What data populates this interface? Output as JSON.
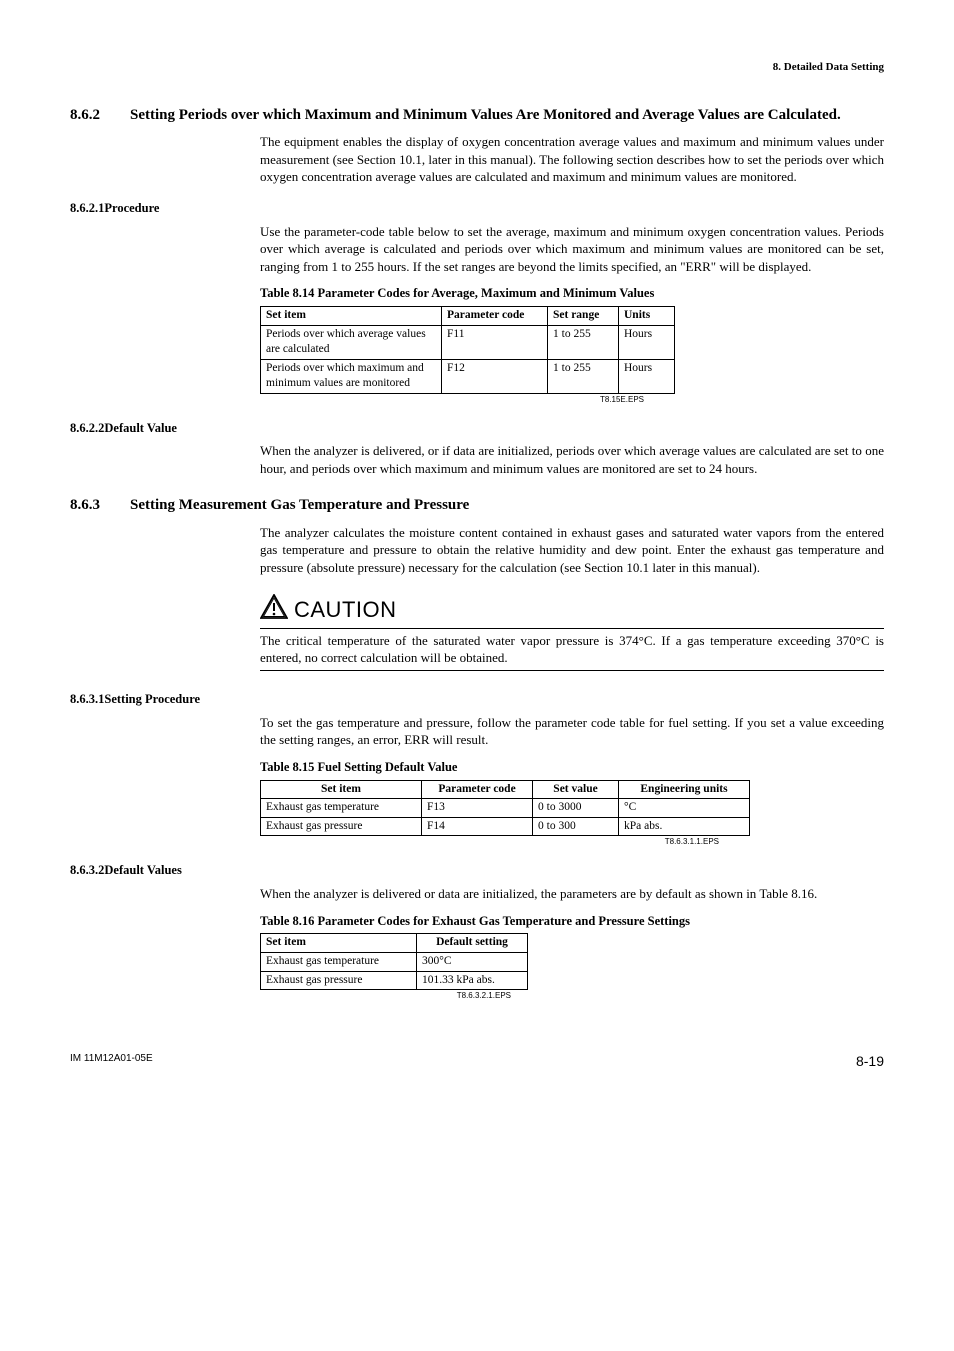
{
  "header": {
    "section": "8.  Detailed Data Setting"
  },
  "s862": {
    "num": "8.6.2",
    "title": "Setting Periods over which Maximum and Minimum Values Are Monitored and Average Values are Calculated.",
    "intro": "The equipment enables the display of oxygen concentration average values and maximum and minimum values under measurement (see Section 10.1, later in this manual). The following section describes how to set the periods over which oxygen concentration average values are calculated and maximum and minimum values are monitored.",
    "s1": {
      "num": "8.6.2.1",
      "title": "Procedure",
      "body": "Use the parameter-code table below to set the average, maximum and minimum oxygen concentration values. Periods over which average is calculated and periods over which maximum and minimum values are monitored can be set, ranging from 1 to 255 hours. If the set ranges are beyond the limits specified, an \"ERR\" will be displayed.",
      "table_caption": "Table 8.14 Parameter Codes for Average, Maximum and Minimum Values",
      "th": {
        "c1": "Set item",
        "c2": "Parameter code",
        "c3": "Set range",
        "c4": "Units"
      },
      "rows": [
        {
          "c1": "Periods over which average values are calculated",
          "c2": "F11",
          "c3": "1 to 255",
          "c4": "Hours"
        },
        {
          "c1": "Periods over which maximum and minimum values are monitored",
          "c2": "F12",
          "c3": "1 to 255",
          "c4": "Hours"
        }
      ],
      "eps": "T8.15E.EPS"
    },
    "s2": {
      "num": "8.6.2.2",
      "title": "Default Value",
      "body": "When the analyzer is delivered, or if data are initialized, periods over which average values are calculated are set to one hour, and periods over which maximum and minimum values are monitored are set to 24 hours."
    }
  },
  "s863": {
    "num": "8.6.3",
    "title": "Setting Measurement Gas Temperature and Pressure",
    "intro": "The analyzer calculates the moisture content contained in exhaust gases and saturated water vapors from the entered gas temperature and pressure to obtain the relative humidity and dew point. Enter the exhaust gas temperature and pressure (absolute pressure) necessary for the calculation (see Section 10.1 later in this manual).",
    "caution_label": "CAUTION",
    "caution_body": "The critical temperature of the saturated water vapor pressure is 374°C. If a gas temperature exceeding 370°C is entered, no correct calculation will be obtained.",
    "s1": {
      "num": "8.6.3.1",
      "title": "Setting Procedure",
      "body": "To set the gas temperature and pressure, follow the parameter code table for fuel setting. If you set a value exceeding the setting ranges, an error, ERR will result.",
      "table_caption": "Table 8.15 Fuel Setting Default Value",
      "th": {
        "c1": "Set item",
        "c2": "Parameter code",
        "c3": "Set value",
        "c4": "Engineering units"
      },
      "rows": [
        {
          "c1": "Exhaust gas temperature",
          "c2": "F13",
          "c3": "0 to 3000",
          "c4": "°C"
        },
        {
          "c1": "Exhaust gas pressure",
          "c2": "F14",
          "c3": "0 to 300",
          "c4": "kPa abs."
        }
      ],
      "eps": "T8.6.3.1.1.EPS"
    },
    "s2": {
      "num": "8.6.3.2",
      "title": "Default Values",
      "body": "When the analyzer is delivered or data are initialized, the parameters are by default as shown in Table 8.16.",
      "table_caption": "Table 8.16 Parameter Codes for Exhaust Gas Temperature and Pressure Settings",
      "th": {
        "c1": "Set item",
        "c2": "Default setting"
      },
      "rows": [
        {
          "c1": "Exhaust gas temperature",
          "c2": "300°C"
        },
        {
          "c1": "Exhaust gas pressure",
          "c2": "101.33 kPa abs."
        }
      ],
      "eps": "T8.6.3.2.1.EPS"
    }
  },
  "footer": {
    "left": "IM 11M12A01-05E",
    "right": "8-19"
  }
}
